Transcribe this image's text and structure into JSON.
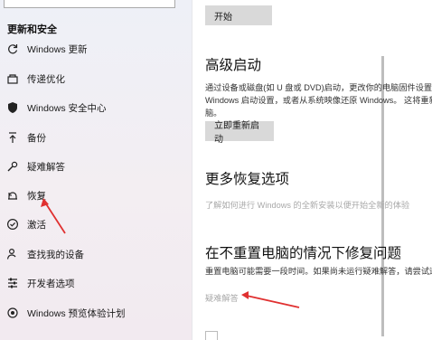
{
  "sidebar": {
    "section_title": "更新和安全",
    "items": [
      {
        "label": "Windows 更新",
        "icon": "sync-icon"
      },
      {
        "label": "传递优化",
        "icon": "delivery-optimization-icon"
      },
      {
        "label": "Windows 安全中心",
        "icon": "shield-icon"
      },
      {
        "label": "备份",
        "icon": "backup-arrow-icon"
      },
      {
        "label": "疑难解答",
        "icon": "wrench-icon"
      },
      {
        "label": "恢复",
        "icon": "recovery-icon"
      },
      {
        "label": "激活",
        "icon": "check-circle-icon"
      },
      {
        "label": "查找我的设备",
        "icon": "person-location-icon"
      },
      {
        "label": "开发者选项",
        "icon": "developer-tools-icon"
      },
      {
        "label": "Windows 预览体验计划",
        "icon": "insider-icon"
      }
    ]
  },
  "main": {
    "start_button": "开始",
    "advanced_startup": {
      "title": "高级启动",
      "desc_lines": [
        "通过设备或磁盘(如 U 盘或 DVD)启动，更改你的电脑固件设置，更改",
        "Windows 启动设置，或者从系统映像还原 Windows。 这将重新启动电",
        "脑。"
      ],
      "restart_button": "立即重新启动"
    },
    "more_recovery": {
      "title": "更多恢复选项",
      "link": "了解如何进行 Windows 的全新安装以便开始全新的体验"
    },
    "fix_without_reset": {
      "title": "在不重置电脑的情况下修复问题",
      "desc": "重置电脑可能需要一段时间。如果尚未运行疑难解答，请尝试运行疑难解答",
      "link": "疑难解答"
    }
  },
  "colors": {
    "accent_arrow": "#e03030",
    "button_bg": "#d9d9d9",
    "muted_link": "#a9a9a9"
  }
}
